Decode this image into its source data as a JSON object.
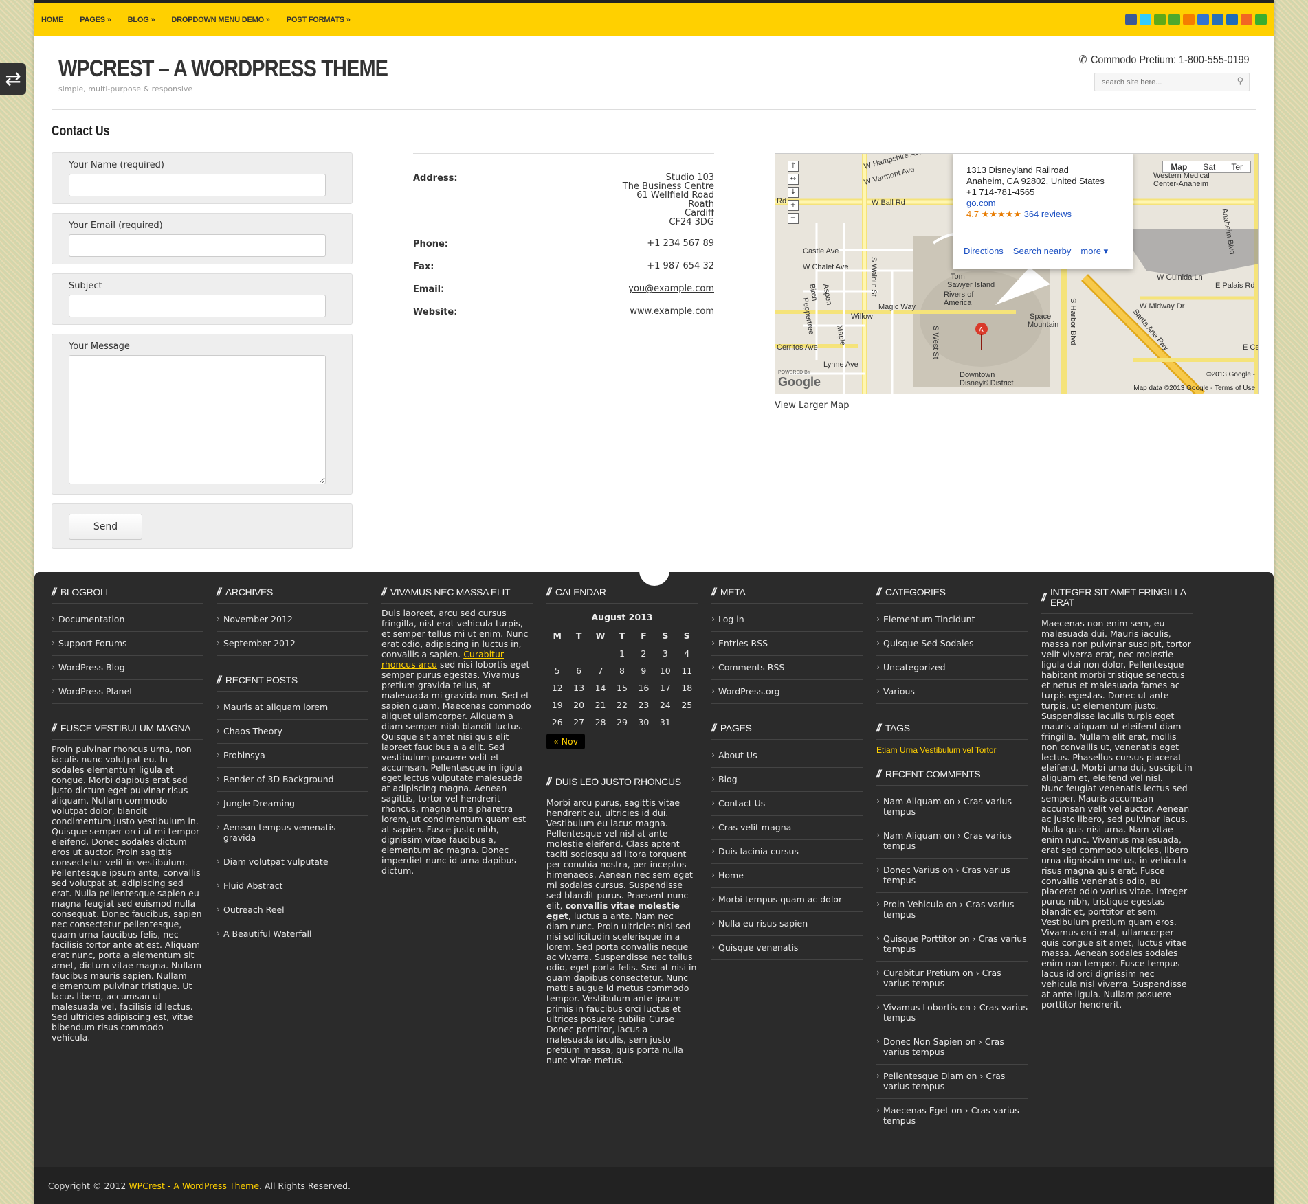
{
  "nav": [
    "Home",
    "Pages »",
    "Blog »",
    "Dropdown Menu Demo »",
    "Post Formats »"
  ],
  "social_icons": [
    {
      "name": "facebook-icon",
      "color": "#3b5998"
    },
    {
      "name": "twitter-icon",
      "color": "#33ccff"
    },
    {
      "name": "google-icon",
      "color": "#60a917"
    },
    {
      "name": "stumbleupon-icon",
      "color": "#4ea82d"
    },
    {
      "name": "blogger-icon",
      "color": "#f57d00"
    },
    {
      "name": "delicious-icon",
      "color": "#3274d1"
    },
    {
      "name": "myspace-icon",
      "color": "#2a6fb5"
    },
    {
      "name": "digg-icon",
      "color": "#1e6bb8"
    },
    {
      "name": "rss-icon",
      "color": "#f26522"
    },
    {
      "name": "skype-icon",
      "color": "#3aae2e"
    }
  ],
  "site": {
    "title": "WPCREST – A WORDPRESS THEME",
    "tagline": "simple, multi-purpose & responsive",
    "phone": "Commodo Pretium: 1-800-555-0199",
    "search_placeholder": "search site here..."
  },
  "page": {
    "title": "Contact Us",
    "form": {
      "name_label": "Your Name (required)",
      "email_label": "Your Email (required)",
      "subject_label": "Subject",
      "message_label": "Your Message",
      "send_label": "Send"
    },
    "info": {
      "address_label": "Address:",
      "address_lines": [
        "Studio 103",
        "The Business Centre",
        "61 Wellfield Road",
        "Roath",
        "Cardiff",
        "CF24 3DG"
      ],
      "phone_label": "Phone:",
      "phone": "+1 234 567 89",
      "fax_label": "Fax:",
      "fax": "+1 987 654 32",
      "email_label": "Email:",
      "email": "you@example.com",
      "website_label": "Website:",
      "website": "www.example.com"
    },
    "map": {
      "popup_lines": [
        "1313 Disneyland Railroad",
        "Anaheim, CA 92802, United States",
        "+1 714-781-4565"
      ],
      "popup_link": "go.com",
      "rating": "4.7 ★★★★★",
      "reviews": "364 reviews",
      "actions": [
        "Directions",
        "Search nearby",
        "more ▾"
      ],
      "types": [
        "Map",
        "Sat",
        "Ter"
      ],
      "copyright": "Map data ©2013 Google - Terms of Use",
      "copyright2": "©2013 Google -",
      "powered_by": "POWERED BY",
      "google": "Google",
      "street_labels": [
        "W Ball Rd",
        "Magic Way",
        "S Walnut St",
        "S West St",
        "S Harbor Blvd",
        "Santa Ana Fwy",
        "Cerritos Ave",
        "W Midway Dr",
        "E Palais Rd",
        "W Guinida Ln",
        "Anaheim Blvd",
        "Downtown Disney® District",
        "Space Mountain",
        "Castle Ave",
        "W Chalet Ave",
        "Willow",
        "Lynne Ave",
        "W Hampshire Ave",
        "W Vermont Ave",
        "Rivers of America",
        "Tom Sawyer Island",
        "Western Medical Center-Anaheim",
        "E Ce",
        "Rd",
        "Birch",
        "Aspen",
        "Peppertree",
        "Maple"
      ],
      "view_larger": "View Larger Map"
    }
  },
  "footer": {
    "blogroll": {
      "title": "BLOGROLL",
      "items": [
        "Documentation",
        "Support Forums",
        "WordPress Blog",
        "WordPress Planet"
      ]
    },
    "fusce": {
      "title": "FUSCE VESTIBULUM MAGNA",
      "text": "Proin pulvinar rhoncus urna, non iaculis nunc volutpat eu. In sodales elementum ligula et congue. Morbi dapibus erat sed justo dictum eget pulvinar risus aliquam. Nullam commodo volutpat dolor, blandit condimentum justo vestibulum in. Quisque semper orci ut mi tempor eleifend. Donec sodales dictum eros ut auctor. Proin sagittis consectetur velit in vestibulum. Pellentesque ipsum ante, convallis sed volutpat at, adipiscing sed erat. Nulla pellentesque sapien eu magna feugiat sed euismod nulla consequat. Donec faucibus, sapien nec consectetur pellentesque, quam urna faucibus felis, nec facilisis tortor ante at est. Aliquam erat nunc, porta a elementum sit amet, dictum vitae magna. Nullam faucibus mauris sapien. Nullam elementum pulvinar tristique. Ut lacus libero, accumsan ut malesuada vel, facilisis id lectus. Sed ultricies adipiscing est, vitae bibendum risus commodo vehicula."
    },
    "archives": {
      "title": "ARCHIVES",
      "items": [
        "November 2012",
        "September 2012"
      ]
    },
    "recent_posts": {
      "title": "RECENT POSTS",
      "items": [
        "Mauris at aliquam lorem",
        "Chaos Theory",
        "Probinsya",
        "Render of 3D Background",
        "Jungle Dreaming",
        "Aenean tempus venenatis gravida",
        "Diam volutpat vulputate",
        "Fluid Abstract",
        "Outreach Reel",
        "A Beautiful Waterfall"
      ]
    },
    "vivamus": {
      "title": "VIVAMUS NEC MASSA ELIT",
      "text_a": "Duis laoreet, arcu sed cursus fringilla, nisl erat vehicula turpis, et semper tellus mi ut enim. Nunc erat odio, adipiscing in luctus in, convallis a sapien. ",
      "link": "Curabitur rhoncus arcu",
      "text_b": " sed nisi lobortis eget semper purus egestas. Vivamus pretium gravida tellus, at malesuada mi gravida non. Sed et sapien quam. Maecenas commodo aliquet ullamcorper. Aliquam a diam semper nibh blandit luctus. Quisque sit amet nisi quis elit laoreet faucibus a a elit. Sed vestibulum posuere velit et accumsan. Pellentesque in ligula eget lectus vulputate malesuada at adipiscing magna. Aenean sagittis, tortor vel hendrerit rhoncus, magna urna pharetra lorem, ut condimentum quam est at sapien. Fusce justo nibh, dignissim vitae faucibus a, elementum ac magna. Donec imperdiet nunc id urna dapibus dictum."
    },
    "calendar": {
      "title": "CALENDAR",
      "caption": "August 2013",
      "days": [
        "M",
        "T",
        "W",
        "T",
        "F",
        "S",
        "S"
      ],
      "weeks": [
        [
          "",
          "",
          "",
          "1",
          "2",
          "3",
          "4"
        ],
        [
          "5",
          "6",
          "7",
          "8",
          "9",
          "10",
          "11"
        ],
        [
          "12",
          "13",
          "14",
          "15",
          "16",
          "17",
          "18"
        ],
        [
          "19",
          "20",
          "21",
          "22",
          "23",
          "24",
          "25"
        ],
        [
          "26",
          "27",
          "28",
          "29",
          "30",
          "31",
          ""
        ]
      ],
      "prev": "« Nov"
    },
    "duis": {
      "title": "DUIS LEO JUSTO RHONCUS",
      "text_a": "Morbi arcu purus, sagittis vitae hendrerit eu, ultricies id dui. Vestibulum eu lacus magna. Pellentesque vel nisl at ante molestie eleifend. Class aptent taciti sociosqu ad litora torquent per conubia nostra, per inceptos himenaeos. Aenean nec sem eget mi sodales cursus. Suspendisse sed blandit purus. Praesent nunc elit, ",
      "bold": "convallis vitae molestie eget",
      "text_b": ", luctus a ante. Nam nec diam nunc. Proin ultricies nisl sed nisi sollicitudin scelerisque in a lorem. Sed porta convallis neque ac viverra. Suspendisse nec tellus odio, eget porta felis. Sed at nisi in quam dapibus consectetur. Nunc mattis augue id metus commodo tempor. Vestibulum ante ipsum primis in faucibus orci luctus et ultrices posuere cubilia Curae Donec porttitor, lacus a malesuada iaculis, sem justo pretium massa, quis porta nulla nunc vitae metus."
    },
    "meta": {
      "title": "META",
      "items": [
        "Log in",
        "Entries RSS",
        "Comments RSS",
        "WordPress.org"
      ]
    },
    "pages": {
      "title": "PAGES",
      "items": [
        "About Us",
        "Blog",
        "Contact Us",
        "Cras velit magna",
        "Duis lacinia cursus",
        "Home",
        "Morbi tempus quam ac dolor",
        "Nulla eu risus sapien",
        "Quisque venenatis"
      ]
    },
    "categories": {
      "title": "CATEGORIES",
      "items": [
        "Elementum Tincidunt",
        "Quisque Sed Sodales",
        "Uncategorized",
        "Various"
      ]
    },
    "tags": {
      "title": "TAGS",
      "text": "Etiam Urna Vestibulum vel Tortor"
    },
    "recent_comments": {
      "title": "RECENT COMMENTS",
      "items": [
        {
          "author": "Nam Aliquam",
          "post": "Cras varius tempus"
        },
        {
          "author": "Nam Aliquam",
          "post": "Cras varius tempus"
        },
        {
          "author": "Donec Varius",
          "post": "Cras varius tempus"
        },
        {
          "author": "Proin Vehicula",
          "post": "Cras varius tempus"
        },
        {
          "author": "Quisque Porttitor",
          "post": "Cras varius tempus"
        },
        {
          "author": "Curabitur Pretium",
          "post": "Cras varius tempus"
        },
        {
          "author": "Vivamus Lobortis",
          "post": "Cras varius tempus"
        },
        {
          "author": "Donec Non Sapien",
          "post": "Cras varius tempus"
        },
        {
          "author": "Pellentesque Diam",
          "post": "Cras varius tempus"
        },
        {
          "author": "Maecenas Eget",
          "post": "Cras varius tempus"
        }
      ],
      "on": "on"
    },
    "integer": {
      "title": "INTEGER SIT AMET FRINGILLA ERAT",
      "text_a": "Maecenas non enim sem, eu malesuada dui. Mauris iaculis, massa non pulvinar suscipit, tortor velit viverra erat, nec molestie ligula dui non dolor. Pellentesque habitant morbi tristique senectus et netus et malesuada fames ac turpis egestas. Donec ut ante turpis, ut elementum justo. Suspendisse iaculis turpis eget mauris aliquam ut eleifend diam fringilla. Nullam elit erat, mollis non convallis ut, venenatis eget lectus. Phasellus cursus placerat eleifend. Morbi urna dui, suscipit in aliquam et, eleifend vel nisl.",
      "text_b": "Nunc feugiat venenatis lectus sed semper. Mauris accumsan accumsan velit vel auctor. Aenean ac justo libero, sed pulvinar lacus. Nulla quis nisi urna. Nam vitae enim nunc. Vivamus malesuada, erat sed commodo ultricies, libero urna dignissim metus, in vehicula risus magna quis erat. Fusce convallis venenatis odio, eu placerat odio varius vitae. Integer purus nibh, tristique egestas blandit et, porttitor et sem. Vestibulum pretium quam eros. Vivamus orci erat, ullamcorper quis congue sit amet, luctus vitae massa. Aenean sodales sodales enim non tempor. Fusce tempus lacus id orci dignissim nec vehicula nisl viverra. Suspendisse at ante ligula. Nullam posuere porttitor hendrerit."
    },
    "copyright_a": "Copyright © 2012 ",
    "copyright_link": "WPCrest - A WordPress Theme",
    "copyright_b": ". All Rights Reserved."
  }
}
